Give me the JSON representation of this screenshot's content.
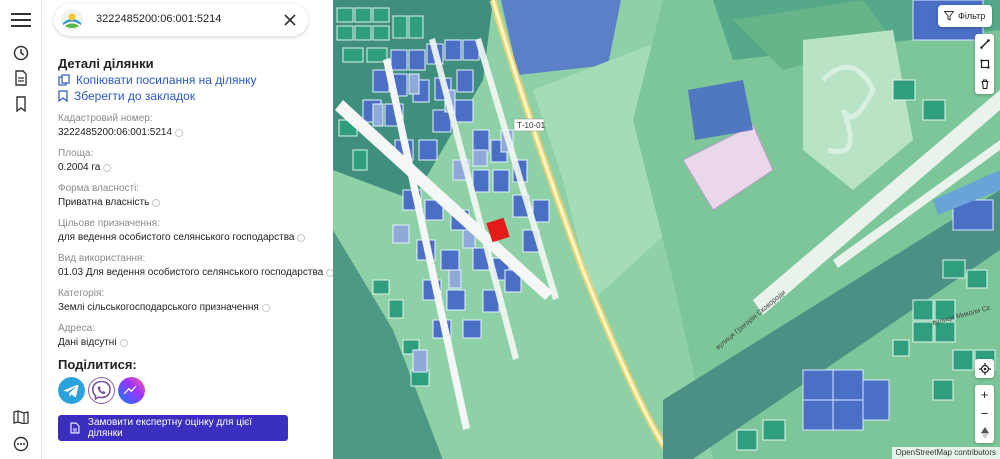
{
  "search": {
    "query": "3222485200:06:001:5214"
  },
  "details": {
    "title": "Деталі ділянки",
    "copy_link": "Копіювати посилання на ділянку",
    "bookmark": "Зберегти до закладок",
    "fields": [
      {
        "label": "Кадастровий номер:",
        "value": "3222485200:06:001:5214"
      },
      {
        "label": "Площа:",
        "value": "0.2004 га"
      },
      {
        "label": "Форма власності:",
        "value": "Приватна власність"
      },
      {
        "label": "Цільове призначення:",
        "value": "для ведення особистого селянського господарства"
      },
      {
        "label": "Вид використання:",
        "value": "01.03 Для ведення особистого селянського господарства"
      },
      {
        "label": "Категорія:",
        "value": "Землі сільськогосподарського призначення"
      },
      {
        "label": "Адреса:",
        "value": "Дані відсутні"
      }
    ],
    "share_title": "Поділитися:",
    "order_button": "Замовити експертну оцінку для цієї ділянки"
  },
  "map": {
    "filter_label": "Фільтр",
    "road_label": "Т-10-01",
    "streets": [
      "вулиця Григорія Сковороди",
      "вулиця Миколи Сє"
    ],
    "attribution": "OpenStreetMap contributors",
    "zoom_in": "+",
    "zoom_out": "−",
    "colors": {
      "land": "#8ed1a7",
      "parcel": "#4a6fc4",
      "selected": "#e31b1b",
      "water": "#6aa3d8"
    }
  }
}
